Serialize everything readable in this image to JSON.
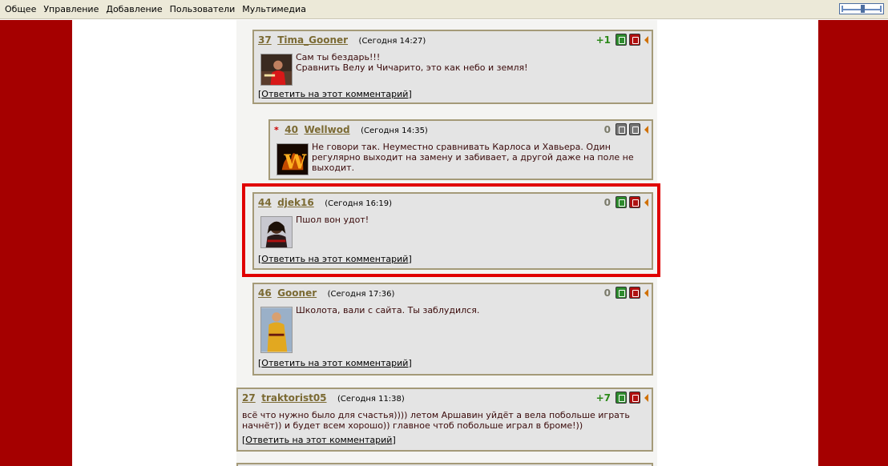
{
  "topbar": {
    "menu": [
      "Общее",
      "Управление",
      "Добавление",
      "Пользователи",
      "Мультимедиа"
    ]
  },
  "reply_label": "Ответить на этот комментарий",
  "comments": [
    {
      "num": "37",
      "author": "Tima_Gooner",
      "time": "(Сегодня 14:27)",
      "score": "+1",
      "score_class": "pos",
      "lines": [
        "Сам ты бездарь!!!",
        "Сравнить Велу и Чичарито, это как небо и земля!"
      ],
      "avatar_icon": "avatar-red-player-icon"
    },
    {
      "num": "40",
      "author": "Wellwod",
      "time": "(Сегодня 14:35)",
      "score": "0",
      "score_class": "zero",
      "star": "*",
      "lines": [
        "Не говори так. Неуместно сравнивать Карлоса и Хавьера. Один",
        "регулярно выходит на замену и забивает, а другой даже на поле не",
        "выходит."
      ],
      "avatar_icon": "avatar-flame-w-icon"
    },
    {
      "num": "44",
      "author": "djek16",
      "time": "(Сегодня 16:19)",
      "score": "0",
      "score_class": "zero",
      "lines": [
        "Пшол вон удот!"
      ],
      "avatar_icon": "avatar-player-dreadlocks-icon"
    },
    {
      "num": "46",
      "author": "Gooner",
      "time": "(Сегодня 17:36)",
      "score": "0",
      "score_class": "zero",
      "lines": [
        "Школота, вали с сайта. Ты заблудился."
      ],
      "avatar_icon": "avatar-player-yellow-kit-icon"
    },
    {
      "num": "27",
      "author": "traktorist05",
      "time": "(Сегодня 11:38)",
      "score": "+7",
      "score_class": "pos",
      "lines": [
        "всё что нужно было для счастья)))) летом Аршавин уйдёт а вела побольше играть",
        "начнёт)) и будет всем хорошо)) главное чтоб побольше играл в броме!))"
      ],
      "avatar_icon": ""
    }
  ],
  "colors": {
    "side": "#a50000",
    "border": "#a49a78",
    "link": "#7b6a33",
    "highlight": "#e00000",
    "positive": "#2d8a1a"
  }
}
